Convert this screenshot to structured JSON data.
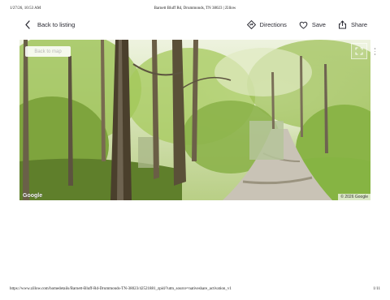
{
  "print": {
    "datetime": "1/27/26, 10:53 AM",
    "title": "Barnett Bluff Rd, Drummonds, TN 38023 | Zillow",
    "url": "https://www.zillow.com/homedetails/Barnett-Bluff-Rd-Drummonds-TN-38023/42521881_zpid/?utm_source=nativeshare_activation_v1",
    "page_number": "1/11"
  },
  "nav": {
    "back_label": "Back to listing",
    "directions_label": "Directions",
    "save_label": "Save",
    "share_label": "Share"
  },
  "streetview": {
    "back_to_map_label": "Back to map",
    "google_logo": "Google",
    "copyright": "© 2026 Google"
  },
  "icons": {
    "back": "chevron-left-icon",
    "directions": "directions-icon",
    "save": "heart-icon",
    "share": "share-icon",
    "fullscreen": "fullscreen-icon",
    "more": "more-vertical-icon"
  },
  "colors": {
    "text": "#2a2a33",
    "foliage": "#8fb54a",
    "path": "#c9c3b6"
  }
}
